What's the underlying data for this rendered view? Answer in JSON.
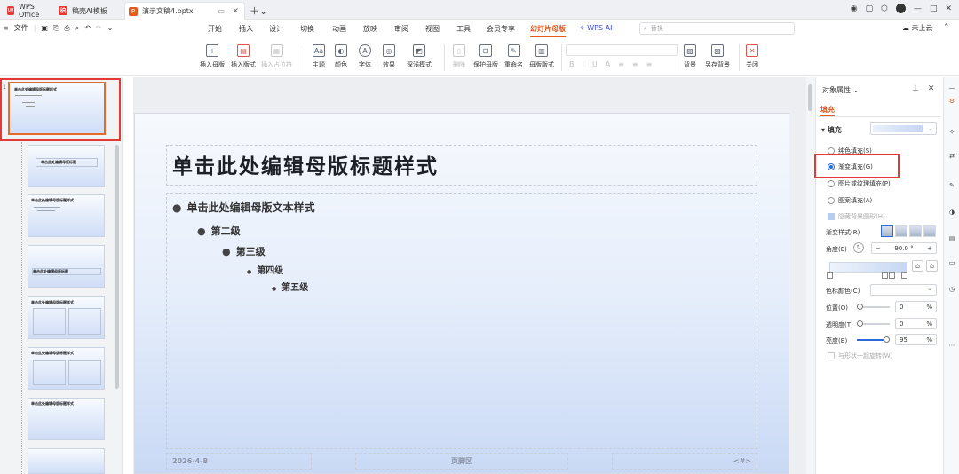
{
  "tabs": [
    {
      "label": "WPS Office",
      "icon": "wps-logo-icon",
      "color": "#e53935"
    },
    {
      "label": "稿壳AI模板",
      "icon": "template-icon",
      "color": "#e53935"
    },
    {
      "label": "演示文稿4.pptx",
      "icon": "presentation-icon",
      "color": "#e45a1f",
      "active": true
    }
  ],
  "menu": {
    "file": "文件",
    "items": [
      "开始",
      "插入",
      "设计",
      "切换",
      "动画",
      "放映",
      "审阅",
      "视图",
      "工具",
      "会员专享",
      "幻灯片母版",
      "WPS AI"
    ],
    "active": "幻灯片母版",
    "search_placeholder": "替换",
    "cloud": "未上云"
  },
  "ribbon": {
    "buttons": [
      "插入母版",
      "插入版式",
      "插入占位符",
      "主题",
      "颜色",
      "字体",
      "效果",
      "深浅模式",
      "删除",
      "保护母版",
      "重命名",
      "母版版式",
      "背景",
      "另存背景",
      "关闭"
    ],
    "format_glyphs": [
      "B",
      "I",
      "U",
      "A",
      "≡",
      "≡",
      "≡"
    ]
  },
  "slide_panel": {
    "selected_number": "1",
    "thumb_title": "单击此处编辑母版标题样式"
  },
  "slide": {
    "title": "单击此处编辑母版标题样式",
    "levels": [
      "单击此处编辑母版文本样式",
      "第二级",
      "第三级",
      "第四级",
      "第五级"
    ],
    "footer_date": "2026-4-8",
    "footer_text": "页脚区",
    "footer_num": "<#>"
  },
  "properties": {
    "title": "对象属性",
    "tab": "填充",
    "fill_label": "填充",
    "options": [
      "纯色填充(S)",
      "渐变填充(G)",
      "图片或纹理填充(P)",
      "图案填充(A)"
    ],
    "selected_option": "渐变填充(G)",
    "hide_bg": "隐藏背景图形(H)",
    "gradient_style": "渐变样式(R)",
    "angle_label": "角度(E)",
    "angle_value": "90.0",
    "angle_unit": "°",
    "color_label": "色标颜色(C)",
    "position_label": "位置(O)",
    "position_value": "0",
    "transparency_label": "透明度(T)",
    "transparency_value": "0",
    "brightness_label": "亮度(B)",
    "brightness_value": "95",
    "percent": "%",
    "rotate_with_shape": "与形状一起旋转(W)",
    "accent": "#2a6ad9",
    "highlight": "#e53935"
  },
  "right_strip": [
    "对象属性",
    "动画",
    "切换",
    "美化",
    "主题",
    "素材",
    "文本",
    "帮助",
    "分享"
  ]
}
